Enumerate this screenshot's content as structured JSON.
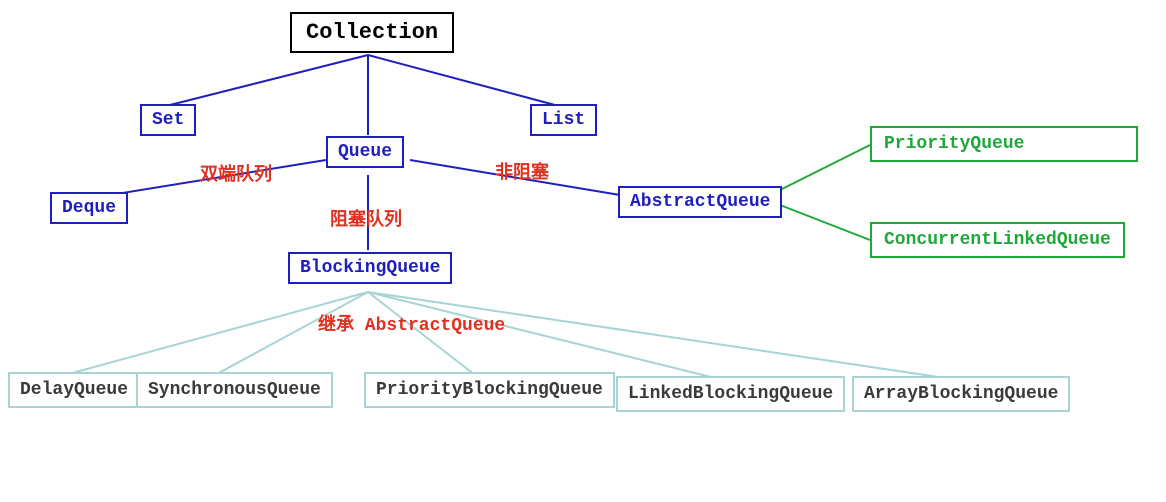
{
  "nodes": {
    "collection": "Collection",
    "set": "Set",
    "queue": "Queue",
    "list": "List",
    "deque": "Deque",
    "abstractQueue": "AbstractQueue",
    "blockingQueue": "BlockingQueue",
    "priorityQueue": "PriorityQueue",
    "concurrentLinkedQueue": "ConcurrentLinkedQueue",
    "delayQueue": "DelayQueue",
    "synchronousQueue": "SynchronousQueue",
    "priorityBlockingQueue": "PriorityBlockingQueue",
    "linkedBlockingQueue": "LinkedBlockingQueue",
    "arrayBlockingQueue": "ArrayBlockingQueue"
  },
  "notes": {
    "doubleEnded": "双端队列",
    "blocking": "阻塞队列",
    "nonBlocking": "非阻塞",
    "inherit": "继承 AbstractQueue"
  },
  "colors": {
    "blue": "#1f1fbf",
    "green": "#1fa83a",
    "teal": "#a8d4d4",
    "red": "#e03020"
  }
}
